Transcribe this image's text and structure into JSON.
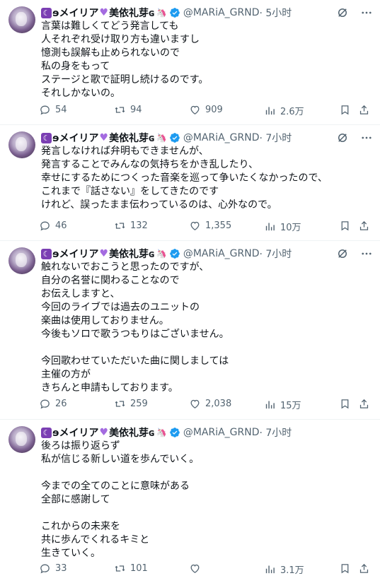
{
  "author": {
    "display_name": "ɘメイリア",
    "display_name_2": "美依礼芽ɢ",
    "handle": "@MARiA_GRND"
  },
  "colors": {
    "text": "#0f1419",
    "muted": "#536471",
    "verified": "#1d9bf0",
    "accent_purple": "#7b3fb3"
  },
  "tweets": [
    {
      "time": "· 5小时",
      "text": "言葉は難しくてどう発言しても\n人それぞれ受け取り方も違いますし\n憶測も誤解も止められないので\n私の身をもって\nステージと歌で証明し続けるのです。\nそれしかないの。",
      "replies": "54",
      "retweets": "94",
      "likes": "909",
      "views": "2.6万"
    },
    {
      "time": "· 7小时",
      "text": "発言しなければ弁明もできませんが、\n発言することでみんなの気持ちをかき乱したり、\n幸せにするためにつくった音楽を巡って争いたくなかったので、\nこれまで『話さない』をしてきたのです\nけれど、誤ったまま伝わっているのは、心外なので。",
      "replies": "46",
      "retweets": "132",
      "likes": "1,355",
      "views": "10万"
    },
    {
      "time": "· 7小时",
      "text": "触れないでおこうと思ったのですが、\n自分の名誉に関わることなので\nお伝えしますと、\n今回のライブでは過去のユニットの\n楽曲は使用しておりません。\n今後もソロで歌うつもりはございません。\n\n今回歌わせていただいた曲に関しましては\n主催の方が\nきちんと申請もしております。",
      "replies": "26",
      "retweets": "259",
      "likes": "2,038",
      "views": "15万"
    },
    {
      "time": "· 7小时",
      "text": "後ろは振り返らず\n私が信じる新しい道を歩んでいく。\n\n今までの全てのことに意味がある\n全部に感謝して\n\nこれからの未来を\n共に歩んでくれるキミと\n生きていく。",
      "replies": "33",
      "retweets": "101",
      "likes": "",
      "views": "3.1万"
    }
  ]
}
